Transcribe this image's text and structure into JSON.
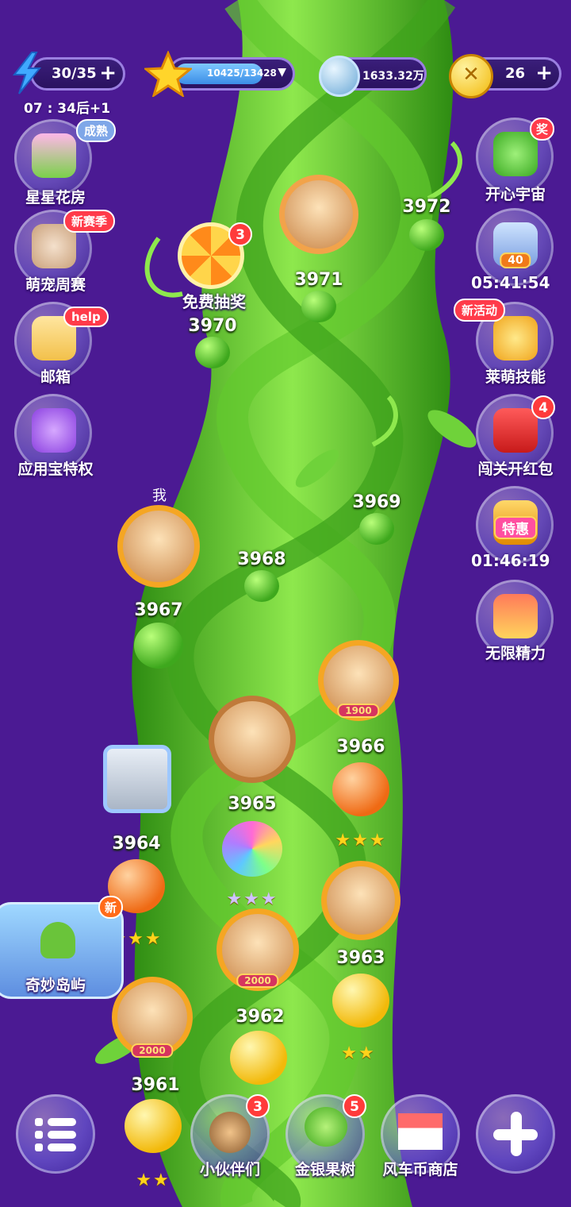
{
  "resources": {
    "energy": "30/35",
    "energy_timer": "07 : 34后+1",
    "stars": "10425/13428",
    "diamonds": "1633.32万",
    "coins": "26"
  },
  "left_menu": [
    {
      "label": "星星花房",
      "tag": "成熟"
    },
    {
      "label": "萌宠周赛",
      "tag": "新赛季"
    },
    {
      "label": "邮箱",
      "tag": "help"
    },
    {
      "label": "应用宝特权"
    }
  ],
  "right_menu": [
    {
      "label": "开心宇宙",
      "tag": "奖"
    },
    {
      "label": "05:41:54",
      "plate": "40"
    },
    {
      "label": "莱萌技能",
      "tag": "新活动"
    },
    {
      "label": "闯关开红包",
      "badge": "4"
    },
    {
      "label": "01:46:19",
      "plate": "特惠"
    },
    {
      "label": "无限精力"
    }
  ],
  "lottery": {
    "label": "免费抽奖",
    "badge": "3"
  },
  "island": {
    "label": "奇妙岛屿",
    "tag": "新"
  },
  "me_label": "我",
  "levels": [
    {
      "num": "3972"
    },
    {
      "num": "3971"
    },
    {
      "num": "3970"
    },
    {
      "num": "3969"
    },
    {
      "num": "3968"
    },
    {
      "num": "3967"
    },
    {
      "num": "3966"
    },
    {
      "num": "3965"
    },
    {
      "num": "3964"
    },
    {
      "num": "3963"
    },
    {
      "num": "3962"
    },
    {
      "num": "3961"
    }
  ],
  "frame_plates": {
    "a": "1900",
    "b": "2000",
    "c": "2000"
  },
  "bottom_bar": {
    "partners": {
      "label": "小伙伴们",
      "badge": "3"
    },
    "tree": {
      "label": "金银果树",
      "badge": "5"
    },
    "shop": {
      "label": "风车币商店"
    }
  },
  "colors": {
    "background": "#4b1a93",
    "vine": "#3ea81d",
    "accent": "#f5a623"
  }
}
